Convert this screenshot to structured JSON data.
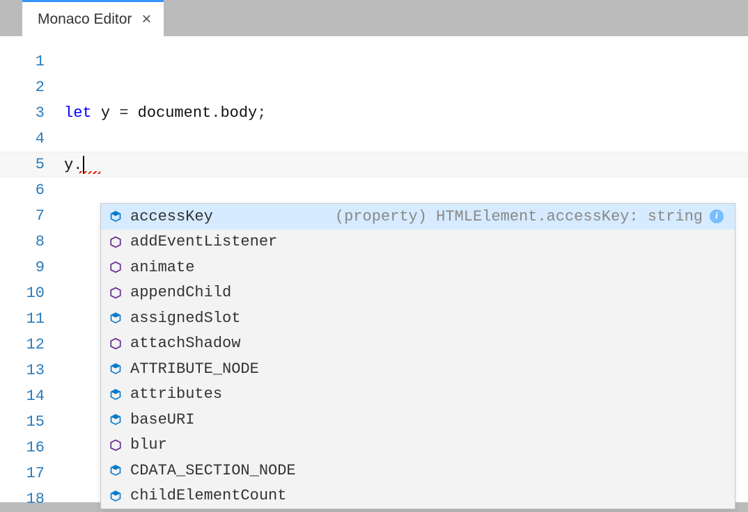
{
  "tab": {
    "title": "Monaco Editor"
  },
  "editor": {
    "lines": [
      {
        "num": "1",
        "tokens": []
      },
      {
        "num": "2",
        "tokens": []
      },
      {
        "num": "3",
        "tokens": [
          {
            "cls": "tok-keyword",
            "t": "let"
          },
          {
            "cls": "",
            "t": " "
          },
          {
            "cls": "tok-ident",
            "t": "y"
          },
          {
            "cls": "",
            "t": " "
          },
          {
            "cls": "tok-punct",
            "t": "="
          },
          {
            "cls": "",
            "t": " "
          },
          {
            "cls": "tok-ident",
            "t": "document"
          },
          {
            "cls": "tok-punct",
            "t": "."
          },
          {
            "cls": "tok-ident",
            "t": "body"
          },
          {
            "cls": "tok-punct",
            "t": ";"
          }
        ]
      },
      {
        "num": "4",
        "tokens": []
      },
      {
        "num": "5",
        "current": true,
        "squiggle": true,
        "cursor": true,
        "tokens": [
          {
            "cls": "tok-ident",
            "t": "y"
          },
          {
            "cls": "tok-punct",
            "t": "."
          }
        ]
      },
      {
        "num": "6",
        "tokens": []
      },
      {
        "num": "7",
        "tokens": []
      },
      {
        "num": "8",
        "tokens": []
      },
      {
        "num": "9",
        "tokens": []
      },
      {
        "num": "10",
        "tokens": []
      },
      {
        "num": "11",
        "tokens": []
      },
      {
        "num": "12",
        "tokens": []
      },
      {
        "num": "13",
        "tokens": []
      },
      {
        "num": "14",
        "tokens": []
      },
      {
        "num": "15",
        "tokens": []
      },
      {
        "num": "16",
        "tokens": []
      },
      {
        "num": "17",
        "tokens": []
      },
      {
        "num": "18",
        "tokens": []
      }
    ]
  },
  "suggest": {
    "detail": "(property) HTMLElement.accessKey: string",
    "items": [
      {
        "kind": "field",
        "label": "accessKey",
        "selected": true
      },
      {
        "kind": "method",
        "label": "addEventListener"
      },
      {
        "kind": "method",
        "label": "animate"
      },
      {
        "kind": "method",
        "label": "appendChild"
      },
      {
        "kind": "field",
        "label": "assignedSlot"
      },
      {
        "kind": "method",
        "label": "attachShadow"
      },
      {
        "kind": "field",
        "label": "ATTRIBUTE_NODE"
      },
      {
        "kind": "field",
        "label": "attributes"
      },
      {
        "kind": "field",
        "label": "baseURI"
      },
      {
        "kind": "method",
        "label": "blur"
      },
      {
        "kind": "field",
        "label": "CDATA_SECTION_NODE"
      },
      {
        "kind": "field",
        "label": "childElementCount"
      }
    ]
  }
}
